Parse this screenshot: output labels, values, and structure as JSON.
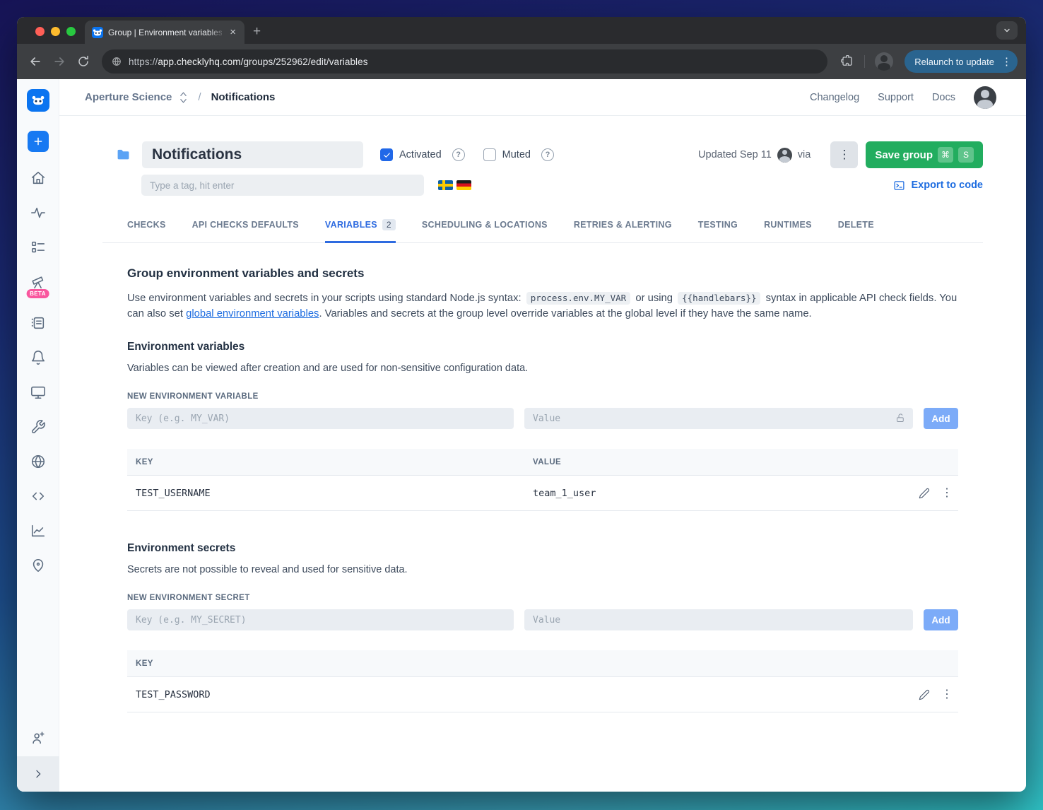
{
  "browser": {
    "tab_title": "Group | Environment variables",
    "close_icon": "×",
    "new_tab_icon": "+",
    "url": {
      "scheme": "https://",
      "host": "app.checklyhq.com",
      "path": "/groups/252962/edit/variables"
    },
    "relaunch_label": "Relaunch to update",
    "kebab_icon": "⋮"
  },
  "topnav": {
    "account_name": "Aperture Science",
    "breadcrumb_separator": "/",
    "page_name": "Notifications",
    "link_changelog": "Changelog",
    "link_support": "Support",
    "link_docs": "Docs"
  },
  "group_header": {
    "name_value": "Notifications",
    "activated_label": "Activated",
    "muted_label": "Muted",
    "help_glyph": "?",
    "tag_placeholder": "Type a tag, hit enter",
    "updated_text": "Updated Sep 11",
    "via_text": "via",
    "menu_icon": "⋮",
    "save_button": "Save group",
    "shortcut_cmd": "⌘",
    "shortcut_key": "S",
    "export_link": "Export to code"
  },
  "tabs": {
    "items": [
      {
        "label": "CHECKS"
      },
      {
        "label": "API CHECKS DEFAULTS"
      },
      {
        "label": "VARIABLES",
        "badge": "2"
      },
      {
        "label": "SCHEDULING & LOCATIONS"
      },
      {
        "label": "RETRIES & ALERTING"
      },
      {
        "label": "TESTING"
      },
      {
        "label": "RUNTIMES"
      },
      {
        "label": "DELETE"
      }
    ]
  },
  "content": {
    "title": "Group environment variables and secrets",
    "intro": {
      "part1": "Use environment variables and secrets in your scripts using standard Node.js syntax:",
      "code1": "process.env.MY_VAR",
      "part2": "or using",
      "code2": "{{handlebars}}",
      "part3": "syntax in applicable API check fields. You can also set",
      "link": "global environment variables",
      "part4": ". Variables and secrets at the group level override variables at the global level if they have the same name."
    },
    "variables": {
      "title": "Environment variables",
      "description": "Variables can be viewed after creation and are used for non-sensitive configuration data.",
      "form_label": "NEW ENVIRONMENT VARIABLE",
      "key_placeholder": "Key (e.g. MY_VAR)",
      "value_placeholder": "Value",
      "add_button": "Add",
      "col_key": "KEY",
      "col_value": "VALUE",
      "rows": [
        {
          "key": "TEST_USERNAME",
          "value": "team_1_user"
        }
      ]
    },
    "secrets": {
      "title": "Environment secrets",
      "description": "Secrets are not possible to reveal and used for sensitive data.",
      "form_label": "NEW ENVIRONMENT SECRET",
      "key_placeholder": "Key (e.g. MY_SECRET)",
      "value_placeholder": "Value",
      "add_button": "Add",
      "col_key": "KEY",
      "rows": [
        {
          "key": "TEST_PASSWORD"
        }
      ]
    }
  },
  "sidebar": {
    "beta_badge": "BETA"
  },
  "colors": {
    "brand_blue": "#0b74f0",
    "active_tab_blue": "#2e6be0",
    "save_green": "#22ad5f",
    "link_blue": "#1d6ce0",
    "beta_pink": "#f9569e",
    "checkbox_blue": "#2168e8"
  }
}
